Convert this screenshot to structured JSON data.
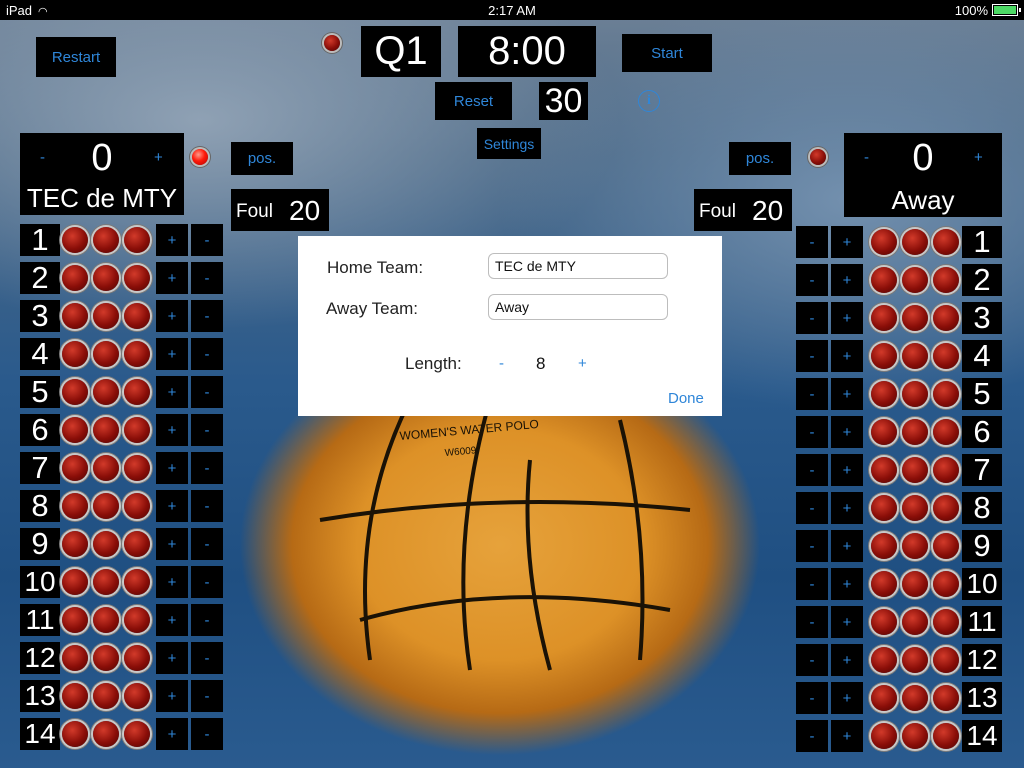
{
  "status_bar": {
    "device": "iPad",
    "time": "2:17 AM",
    "battery": "100%"
  },
  "controls": {
    "restart": "Restart",
    "quarter": "Q1",
    "clock": "8:00",
    "start": "Start",
    "reset": "Reset",
    "shot_clock": "30",
    "settings": "Settings",
    "info_icon": "info-icon"
  },
  "home": {
    "name": "TEC de MTY",
    "score": "0",
    "minus": "-",
    "plus": "+",
    "pos": "pos.",
    "foul_label": "Foul",
    "foul_value": "20",
    "possession_led": "on"
  },
  "away": {
    "name": "Away",
    "score": "0",
    "minus": "-",
    "plus": "+",
    "pos": "pos.",
    "foul_label": "Foul",
    "foul_value": "20",
    "possession_led": "off"
  },
  "players": [
    "1",
    "2",
    "3",
    "4",
    "5",
    "6",
    "7",
    "8",
    "9",
    "10",
    "11",
    "12",
    "13",
    "14"
  ],
  "player_controls": {
    "plus": "+",
    "minus": "-"
  },
  "dialog": {
    "home_label": "Home Team:",
    "home_value": "TEC de MTY",
    "away_label": "Away Team:",
    "away_value": "Away",
    "length_label": "Length:",
    "length_minus": "-",
    "length_value": "8",
    "length_plus": "+",
    "done": "Done"
  },
  "ball": {
    "text_line1": "WOMEN'S WATER POLO",
    "text_line2": "W6009"
  },
  "colors": {
    "accent": "#2f86d8",
    "led_red": "#8a0e08",
    "panel": "#000000"
  }
}
